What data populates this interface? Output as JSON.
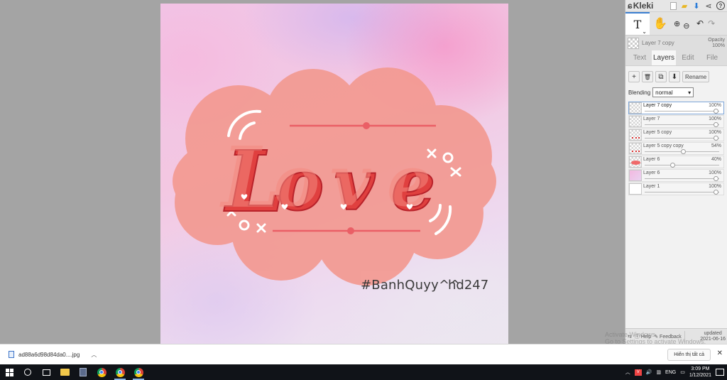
{
  "canvas": {
    "hashtag_text": "#BanhQuyy^^",
    "author_text": "hd247"
  },
  "app": {
    "name": "Kleki",
    "colors": {
      "accent": "#3b7fd1",
      "artwork_cloud": "#f49a92",
      "artwork_letters": "#e0403f"
    }
  },
  "top_icons": [
    "new-image-icon",
    "open-folder-icon",
    "download-icon",
    "share-icon",
    "help-icon"
  ],
  "toolbar": {
    "text_tool_label": "T",
    "text_tool_sub": "⌄",
    "hand_glyph": "✋",
    "zoom_in_glyph": "⊕",
    "zoom_out_glyph": "⊖",
    "undo_glyph": "↶",
    "redo_glyph": "↷"
  },
  "current_layer": {
    "name": "Layer 7 copy",
    "opacity_label": "Opacity",
    "opacity_value": "100%"
  },
  "tabs": [
    "Text",
    "Layers",
    "Edit",
    "File"
  ],
  "layer_buttons": {
    "add": "+",
    "delete": "🗑",
    "duplicate": "⧉",
    "merge": "⬇",
    "rename": "Rename"
  },
  "blending": {
    "label": "Blending",
    "value": "normal"
  },
  "layers": [
    {
      "name": "Layer 7 copy",
      "opacity": "100%",
      "opacity_fraction": 1.0,
      "selected": true,
      "thumb": "transparent"
    },
    {
      "name": "Layer 7",
      "opacity": "100%",
      "opacity_fraction": 1.0,
      "selected": false,
      "thumb": "transparent"
    },
    {
      "name": "Layer 5 copy",
      "opacity": "100%",
      "opacity_fraction": 1.0,
      "selected": false,
      "thumb": "scribble"
    },
    {
      "name": "Layer 5 copy copy",
      "opacity": "54%",
      "opacity_fraction": 0.54,
      "selected": false,
      "thumb": "scribble"
    },
    {
      "name": "Layer 6",
      "opacity": "40%",
      "opacity_fraction": 0.4,
      "selected": false,
      "thumb": "red"
    },
    {
      "name": "Layer 6",
      "opacity": "100%",
      "opacity_fraction": 1.0,
      "selected": false,
      "thumb": "pink"
    },
    {
      "name": "Layer 1",
      "opacity": "100%",
      "opacity_fraction": 1.0,
      "selected": false,
      "thumb": "white"
    }
  ],
  "sidebar_footer": {
    "help": "Help",
    "feedback": "Feedback",
    "updated_label": "updated",
    "updated_date": "2021-06-16"
  },
  "watermark": {
    "line1": "Activate Windows",
    "line2": "Go to Settings to activate Windows."
  },
  "download_bar": {
    "filename": "ad88a6d98d84da0....jpg",
    "show_all": "Hiển thị tất cả",
    "close": "✕"
  },
  "taskbar": {
    "lang": "ENG",
    "time": "3:09 PM",
    "date": "1/12/2021"
  }
}
